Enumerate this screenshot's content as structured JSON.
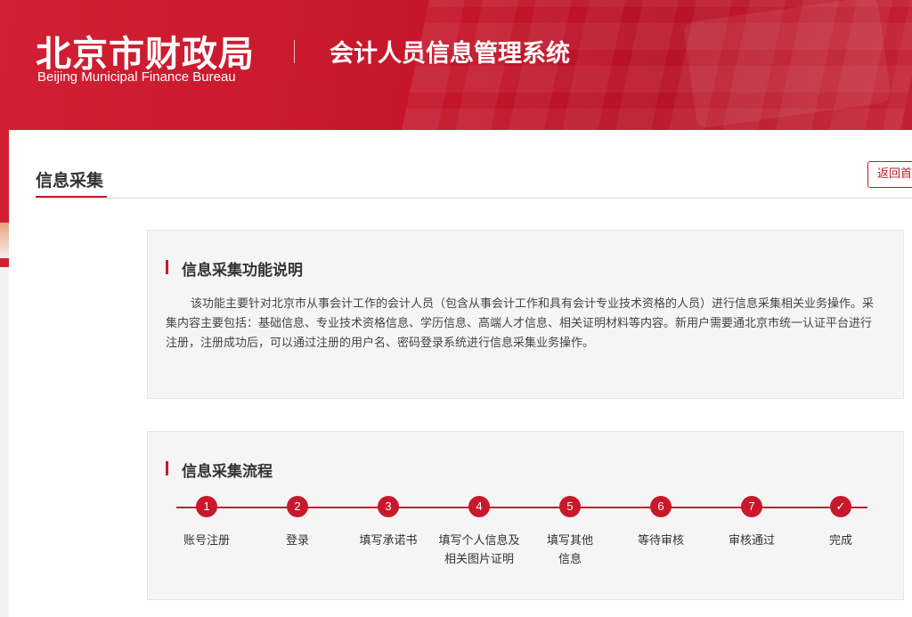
{
  "header": {
    "logo_cn": "北京市财政局",
    "logo_en": "Beijing Municipal Finance Bureau",
    "system_title": "会计人员信息管理系统"
  },
  "page": {
    "title": "信息采集",
    "back_button": "返回首"
  },
  "intro": {
    "heading": "信息采集功能说明",
    "text": "该功能主要针对北京市从事会计工作的会计人员（包含从事会计工作和具有会计专业技术资格的人员）进行信息采集相关业务操作。采集内容主要包括：基础信息、专业技术资格信息、学历信息、高端人才信息、相关证明材料等内容。新用户需要通北京市统一认证平台进行注册，注册成功后，可以通过注册的用户名、密码登录系统进行信息采集业务操作。"
  },
  "process": {
    "heading": "信息采集流程",
    "steps": [
      {
        "num": "1",
        "label": "账号注册"
      },
      {
        "num": "2",
        "label": "登录"
      },
      {
        "num": "3",
        "label": "填写承诺书"
      },
      {
        "num": "4",
        "label": "填写个人信息及\n相关图片证明"
      },
      {
        "num": "5",
        "label": "填写其他\n信息"
      },
      {
        "num": "6",
        "label": "等待审核"
      },
      {
        "num": "7",
        "label": "审核通过"
      },
      {
        "num": "✓",
        "label": "完成"
      }
    ]
  },
  "colors": {
    "brand_red": "#c8182b",
    "card_bg": "#f5f5f5"
  }
}
